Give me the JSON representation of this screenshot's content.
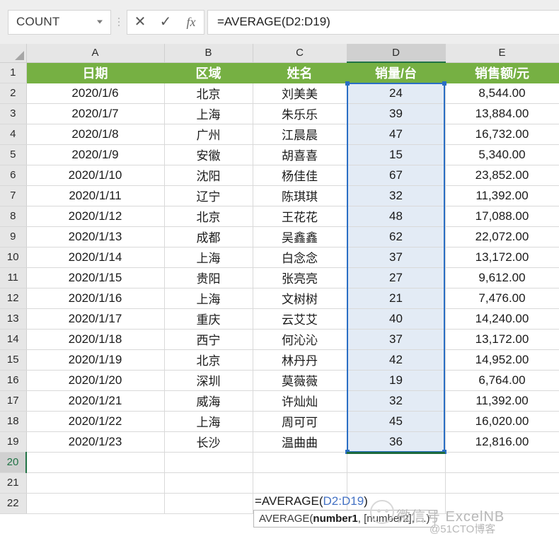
{
  "formula_bar": {
    "name_box_value": "COUNT",
    "cancel_icon": "x-icon",
    "confirm_icon": "check-icon",
    "function_icon": "fx-icon",
    "formula_value": "=AVERAGE(D2:D19)"
  },
  "grid": {
    "corner_icon": "select-all-triangle-icon",
    "column_headers": [
      "A",
      "B",
      "C",
      "D",
      "E"
    ],
    "selected_column": "D",
    "active_row": "20",
    "row_numbers": [
      "1",
      "2",
      "3",
      "4",
      "5",
      "6",
      "7",
      "8",
      "9",
      "10",
      "11",
      "12",
      "13",
      "14",
      "15",
      "16",
      "17",
      "18",
      "19",
      "20",
      "21",
      "22"
    ],
    "table_headers": [
      "日期",
      "区域",
      "姓名",
      "销量/台",
      "销售额/元"
    ],
    "rows": [
      {
        "date": "2020/1/6",
        "region": "北京",
        "name": "刘美美",
        "qty": "24",
        "amount": "8,544.00"
      },
      {
        "date": "2020/1/7",
        "region": "上海",
        "name": "朱乐乐",
        "qty": "39",
        "amount": "13,884.00"
      },
      {
        "date": "2020/1/8",
        "region": "广州",
        "name": "江晨晨",
        "qty": "47",
        "amount": "16,732.00"
      },
      {
        "date": "2020/1/9",
        "region": "安徽",
        "name": "胡喜喜",
        "qty": "15",
        "amount": "5,340.00"
      },
      {
        "date": "2020/1/10",
        "region": "沈阳",
        "name": "杨佳佳",
        "qty": "67",
        "amount": "23,852.00"
      },
      {
        "date": "2020/1/11",
        "region": "辽宁",
        "name": "陈琪琪",
        "qty": "32",
        "amount": "11,392.00"
      },
      {
        "date": "2020/1/12",
        "region": "北京",
        "name": "王花花",
        "qty": "48",
        "amount": "17,088.00"
      },
      {
        "date": "2020/1/13",
        "region": "成都",
        "name": "吴鑫鑫",
        "qty": "62",
        "amount": "22,072.00"
      },
      {
        "date": "2020/1/14",
        "region": "上海",
        "name": "白念念",
        "qty": "37",
        "amount": "13,172.00"
      },
      {
        "date": "2020/1/15",
        "region": "贵阳",
        "name": "张亮亮",
        "qty": "27",
        "amount": "9,612.00"
      },
      {
        "date": "2020/1/16",
        "region": "上海",
        "name": "文树树",
        "qty": "21",
        "amount": "7,476.00"
      },
      {
        "date": "2020/1/17",
        "region": "重庆",
        "name": "云艾艾",
        "qty": "40",
        "amount": "14,240.00"
      },
      {
        "date": "2020/1/18",
        "region": "西宁",
        "name": "何沁沁",
        "qty": "37",
        "amount": "13,172.00"
      },
      {
        "date": "2020/1/19",
        "region": "北京",
        "name": "林丹丹",
        "qty": "42",
        "amount": "14,952.00"
      },
      {
        "date": "2020/1/20",
        "region": "深圳",
        "name": "莫薇薇",
        "qty": "19",
        "amount": "6,764.00"
      },
      {
        "date": "2020/1/21",
        "region": "威海",
        "name": "许灿灿",
        "qty": "32",
        "amount": "11,392.00"
      },
      {
        "date": "2020/1/22",
        "region": "上海",
        "name": "周可可",
        "qty": "45",
        "amount": "16,020.00"
      },
      {
        "date": "2020/1/23",
        "region": "长沙",
        "name": "温曲曲",
        "qty": "36",
        "amount": "12,816.00"
      }
    ]
  },
  "cell_edit": {
    "prefix": "=AVERAGE(",
    "reference": "D2:D19",
    "suffix": ")"
  },
  "tooltip": {
    "prefix": "AVERAGE(",
    "bold_arg": "number1",
    "rest": ", [number2], ...)"
  },
  "watermarks": {
    "line1": "微信号 ExcelNB",
    "line2": "@51CTO博客",
    "logo_icon": "wechat-avatar-icon"
  },
  "colors": {
    "header_green": "#76b043",
    "selection_blue": "#2a6ec4",
    "selection_fill": "#e3ebf5",
    "active_green": "#217346",
    "reference_blue": "#4472c4"
  }
}
